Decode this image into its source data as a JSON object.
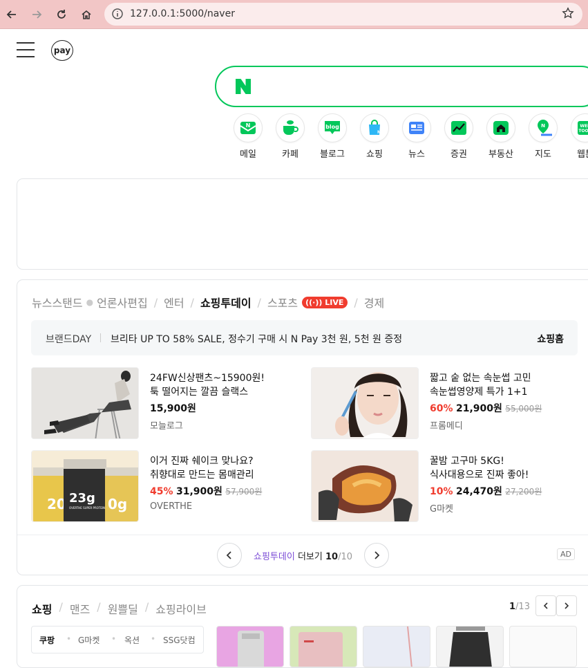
{
  "browser": {
    "url": "127.0.0.1:5000/naver"
  },
  "header": {
    "pay_label": "pay"
  },
  "shortcuts": [
    {
      "label": "메일",
      "icon": "mail-icon",
      "color": "#03c75a"
    },
    {
      "label": "카페",
      "icon": "cafe-icon",
      "color": "#03c75a"
    },
    {
      "label": "블로그",
      "icon": "blog-icon",
      "color": "#03c75a"
    },
    {
      "label": "쇼핑",
      "icon": "shopping-icon",
      "color": "#2db7f5"
    },
    {
      "label": "뉴스",
      "icon": "news-icon",
      "color": "#3f83f8"
    },
    {
      "label": "증권",
      "icon": "stock-icon",
      "color": "#03c75a"
    },
    {
      "label": "부동산",
      "icon": "realestate-icon",
      "color": "#03c75a"
    },
    {
      "label": "지도",
      "icon": "map-icon",
      "color": "#03c75a"
    },
    {
      "label": "웹툰",
      "icon": "webtoon-icon",
      "color": "#03c75a"
    }
  ],
  "news": {
    "tabs": [
      "뉴스스탠드",
      "언론사편집",
      "엔터",
      "쇼핑투데이",
      "스포츠",
      "경제"
    ],
    "live_badge": "LIVE",
    "brand_label": "브랜드DAY",
    "promo_text": "브리타 UP TO 58% SALE, 정수기 구매 시 N Pay 3천 원, 5천 원 증정",
    "shop_home": "쇼핑홈",
    "items": [
      {
        "line1": "24FW신상팬츠~15900원!",
        "line2": "툭 떨어지는 깔끔 슬랙스",
        "discount": "",
        "price": "15,900원",
        "orig": "",
        "seller": "모늘로그"
      },
      {
        "line1": "짧고 숱 없는 속눈썹 고민",
        "line2": "속눈썹영양제 특가 1+1",
        "discount": "60%",
        "price": "21,900원",
        "orig": "55,000원",
        "seller": "프롬메디"
      },
      {
        "line1": "이거 진짜 쉐이크 맞나요?",
        "line2": "취향대로 만드는 몸매관리",
        "discount": "45%",
        "price": "31,900원",
        "orig": "57,900원",
        "seller": "OVERTHE"
      },
      {
        "line1": "꿀밤 고구마 5KG!",
        "line2": "식사대용으로 진짜 좋아!",
        "discount": "10%",
        "price": "24,470원",
        "orig": "27,200원",
        "seller": "G마켓"
      }
    ],
    "product_text": {
      "big": "23g",
      "small": "20",
      "side": "0g",
      "brand": "OVERTHE SUPER PROTEIN"
    },
    "pager": {
      "source": "쇼핑투데이",
      "more": "더보기",
      "current": "10",
      "total": "/10"
    },
    "ad_label": "AD"
  },
  "shopping": {
    "tabs": [
      "쇼핑",
      "맨즈",
      "원쁠딜",
      "쇼핑라이브"
    ],
    "page_current": "1",
    "page_total": "/13",
    "subtabs": [
      "쿠팡",
      "G마켓",
      "옥션",
      "SSG닷컴"
    ]
  }
}
